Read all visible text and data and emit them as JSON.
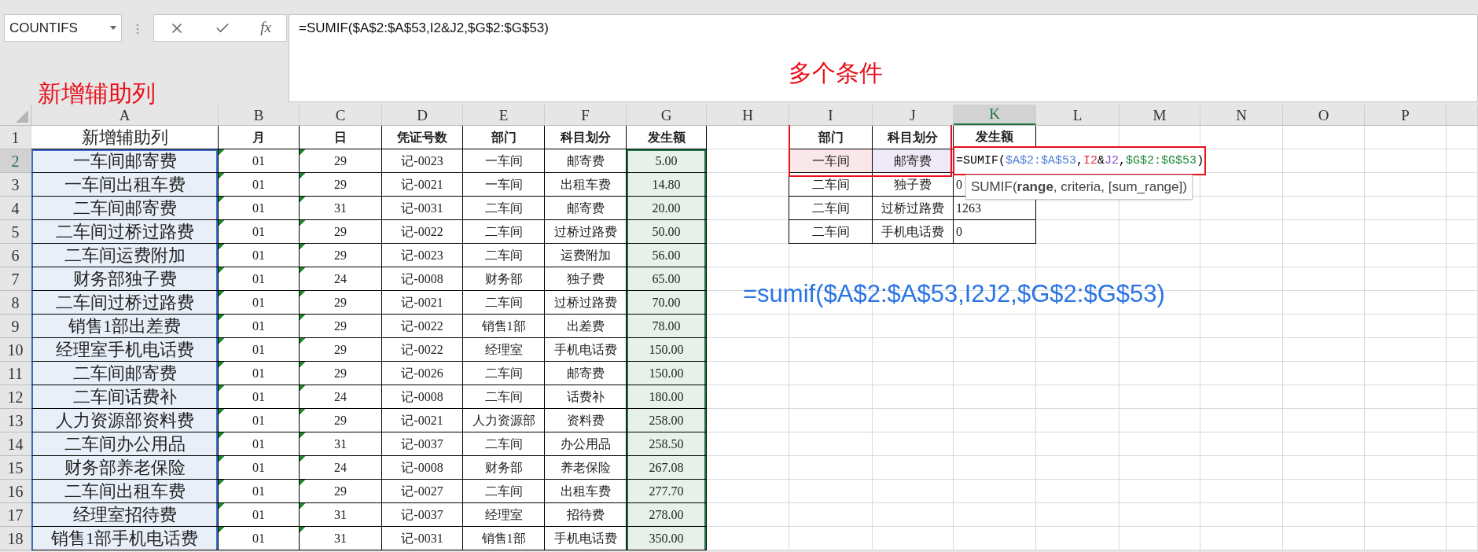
{
  "name_box": {
    "value": "COUNTIFS"
  },
  "formula_bar": {
    "function_button": "fx",
    "value": "=SUMIF($A$2:$A$53,I2&J2,$G$2:$G$53)"
  },
  "annotations": [
    {
      "kind": "note",
      "text": "新增辅助列"
    },
    {
      "kind": "note",
      "text": "多个条件"
    },
    {
      "kind": "formula",
      "text": "=sumif($A$2:$A$53,I2J2,$G$2:$G$53)"
    }
  ],
  "sheet": {
    "column_headers": [
      {
        "label": "A",
        "selected": false
      },
      {
        "label": "B",
        "selected": false
      },
      {
        "label": "C",
        "selected": false
      },
      {
        "label": "D",
        "selected": false
      },
      {
        "label": "E",
        "selected": false
      },
      {
        "label": "F",
        "selected": false
      },
      {
        "label": "G",
        "selected": false
      },
      {
        "label": "H",
        "selected": false
      },
      {
        "label": "I",
        "selected": false
      },
      {
        "label": "J",
        "selected": false
      },
      {
        "label": "K",
        "selected": true
      },
      {
        "label": "L",
        "selected": false
      },
      {
        "label": "M",
        "selected": false
      },
      {
        "label": "N",
        "selected": false
      },
      {
        "label": "O",
        "selected": false
      },
      {
        "label": "P",
        "selected": false
      }
    ],
    "row_headers": [
      {
        "label": "1",
        "selected": false
      },
      {
        "label": "2",
        "selected": true
      },
      {
        "label": "3",
        "selected": false
      },
      {
        "label": "4",
        "selected": false
      },
      {
        "label": "5",
        "selected": false
      },
      {
        "label": "6",
        "selected": false
      },
      {
        "label": "7",
        "selected": false
      },
      {
        "label": "8",
        "selected": false
      },
      {
        "label": "9",
        "selected": false
      },
      {
        "label": "10",
        "selected": false
      },
      {
        "label": "11",
        "selected": false
      },
      {
        "label": "12",
        "selected": false
      },
      {
        "label": "13",
        "selected": false
      },
      {
        "label": "14",
        "selected": false
      },
      {
        "label": "15",
        "selected": false
      },
      {
        "label": "16",
        "selected": false
      },
      {
        "label": "17",
        "selected": false
      },
      {
        "label": "18",
        "selected": false
      }
    ]
  },
  "ledger": {
    "columns": [
      {
        "title": "新增辅助列",
        "color": "#e9eff9",
        "flagged": false
      },
      {
        "title": "月",
        "flagged": true
      },
      {
        "title": "日",
        "flagged": true
      },
      {
        "title": "凭证号数",
        "flagged": false
      },
      {
        "title": "部门",
        "flagged": false
      },
      {
        "title": "科目划分",
        "flagged": false
      },
      {
        "title": "发生额",
        "color": "#e7f1ea",
        "flagged": false
      }
    ],
    "rows": [
      [
        "一车间邮寄费",
        "01",
        "29",
        "记-0023",
        "一车间",
        "邮寄费",
        "5.00"
      ],
      [
        "一车间出租车费",
        "01",
        "29",
        "记-0021",
        "一车间",
        "出租车费",
        "14.80"
      ],
      [
        "二车间邮寄费",
        "01",
        "31",
        "记-0031",
        "二车间",
        "邮寄费",
        "20.00"
      ],
      [
        "二车间过桥过路费",
        "01",
        "29",
        "记-0022",
        "二车间",
        "过桥过路费",
        "50.00"
      ],
      [
        "二车间运费附加",
        "01",
        "29",
        "记-0023",
        "二车间",
        "运费附加",
        "56.00"
      ],
      [
        "财务部独子费",
        "01",
        "24",
        "记-0008",
        "财务部",
        "独子费",
        "65.00"
      ],
      [
        "二车间过桥过路费",
        "01",
        "29",
        "记-0021",
        "二车间",
        "过桥过路费",
        "70.00"
      ],
      [
        "销售1部出差费",
        "01",
        "29",
        "记-0022",
        "销售1部",
        "出差费",
        "78.00"
      ],
      [
        "经理室手机电话费",
        "01",
        "29",
        "记-0022",
        "经理室",
        "手机电话费",
        "150.00"
      ],
      [
        "二车间邮寄费",
        "01",
        "29",
        "记-0026",
        "二车间",
        "邮寄费",
        "150.00"
      ],
      [
        "二车间话费补",
        "01",
        "24",
        "记-0008",
        "二车间",
        "话费补",
        "180.00"
      ],
      [
        "人力资源部资料费",
        "01",
        "29",
        "记-0021",
        "人力资源部",
        "资料费",
        "258.00"
      ],
      [
        "二车间办公用品",
        "01",
        "31",
        "记-0037",
        "二车间",
        "办公用品",
        "258.50"
      ],
      [
        "财务部养老保险",
        "01",
        "24",
        "记-0008",
        "财务部",
        "养老保险",
        "267.08"
      ],
      [
        "二车间出租车费",
        "01",
        "29",
        "记-0027",
        "二车间",
        "出租车费",
        "277.70"
      ],
      [
        "经理室招待费",
        "01",
        "31",
        "记-0037",
        "经理室",
        "招待费",
        "278.00"
      ],
      [
        "销售1部手机电话费",
        "01",
        "31",
        "记-0031",
        "销售1部",
        "手机电话费",
        "350.00"
      ]
    ]
  },
  "lookup": {
    "columns": [
      "部门",
      "科目划分",
      "发生额"
    ],
    "rows": [
      {
        "cells": [
          {
            "text": "一车间",
            "color": "#f9e7e9"
          },
          {
            "text": "邮寄费",
            "color": "#efe9f7"
          }
        ],
        "formula_parts": [
          {
            "text": "=SUMIF("
          },
          {
            "text": "$A$2:$A$53",
            "color": "#4f7fd8"
          },
          {
            "text": ","
          },
          {
            "text": "I2",
            "color": "#d8343f"
          },
          {
            "text": "&"
          },
          {
            "text": "J2",
            "color": "#8a4fc8"
          },
          {
            "text": ","
          },
          {
            "text": "$G$2:$G$53",
            "color": "#1f8a3a"
          },
          {
            "text": ")"
          }
        ]
      },
      {
        "cells": [
          {
            "text": "二车间"
          },
          {
            "text": "独子费"
          },
          {
            "text": "0"
          }
        ]
      },
      {
        "cells": [
          {
            "text": "二车间"
          },
          {
            "text": "过桥过路费"
          },
          {
            "text": "1263"
          }
        ]
      },
      {
        "cells": [
          {
            "text": "二车间"
          },
          {
            "text": "手机电话费"
          },
          {
            "text": "0"
          }
        ]
      }
    ],
    "tooltip": "SUMIF(**range**, criteria, [sum_range])"
  }
}
